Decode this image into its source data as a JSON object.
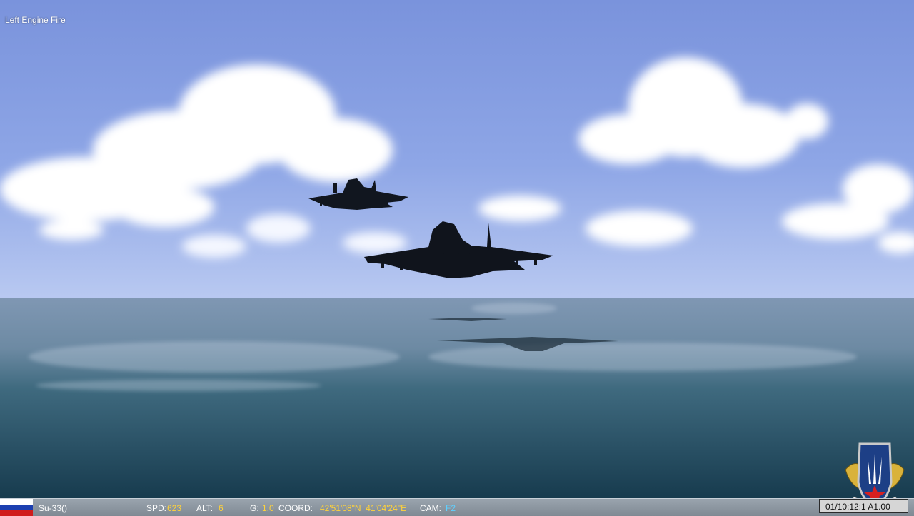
{
  "message": "Left Engine Fire",
  "status": {
    "aircraft": "Su-33()",
    "spd_label": "SPD:",
    "spd_value": "623",
    "alt_label": "ALT:",
    "alt_value": "6",
    "g_label": "G:",
    "g_value": "1.0",
    "coord_label": "COORD:",
    "coord_value": "42'51'08\"N  41'04'24\"E",
    "cam_label": "CAM:",
    "cam_value": "F2",
    "clock": "01/10:12:1 A1.00"
  },
  "icons": {
    "flag": "russian-flag-icon",
    "emblem": "squadron-emblem-icon"
  },
  "colors": {
    "value": "#ffd23a",
    "cam": "#5fd0ff",
    "sky_top": "#7f98de",
    "sky_horizon": "#b8c8f0",
    "sea_top": "#7d95b0",
    "sea_bottom": "#1c4357"
  }
}
